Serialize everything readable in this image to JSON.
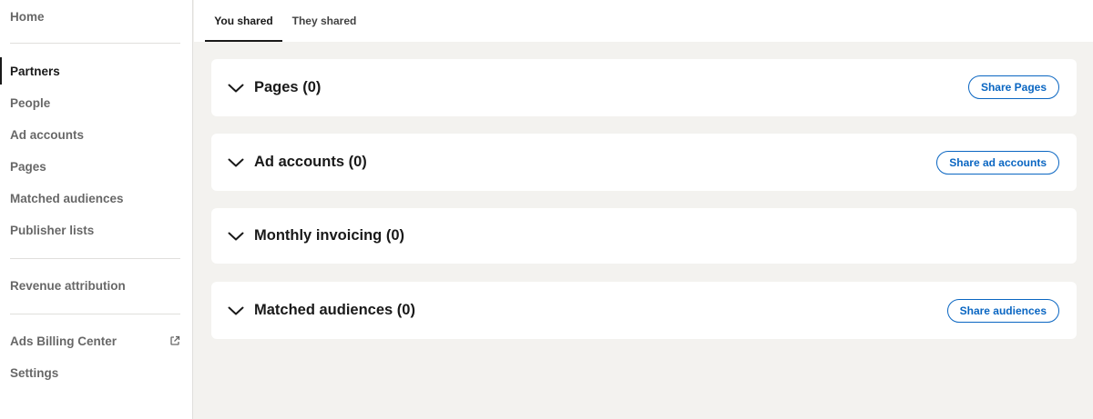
{
  "sidebar": {
    "items": [
      {
        "label": "Home"
      },
      {
        "label": "Partners"
      },
      {
        "label": "People"
      },
      {
        "label": "Ad accounts"
      },
      {
        "label": "Pages"
      },
      {
        "label": "Matched audiences"
      },
      {
        "label": "Publisher lists"
      },
      {
        "label": "Revenue attribution"
      },
      {
        "label": "Ads Billing Center",
        "icon": "external-link-icon"
      },
      {
        "label": "Settings"
      }
    ],
    "active_item": "Partners"
  },
  "tabs": [
    {
      "label": "You shared",
      "active": true
    },
    {
      "label": "They shared",
      "active": false
    }
  ],
  "sections": [
    {
      "title": "Pages (0)",
      "button_label": "Share Pages"
    },
    {
      "title": "Ad accounts (0)",
      "button_label": "Share ad accounts"
    },
    {
      "title": "Monthly invoicing (0)"
    },
    {
      "title": "Matched audiences (0)",
      "button_label": "Share audiences"
    }
  ],
  "colors": {
    "accent": "#0a66c2",
    "page_background": "#f3f2ef",
    "card_background": "#ffffff"
  }
}
